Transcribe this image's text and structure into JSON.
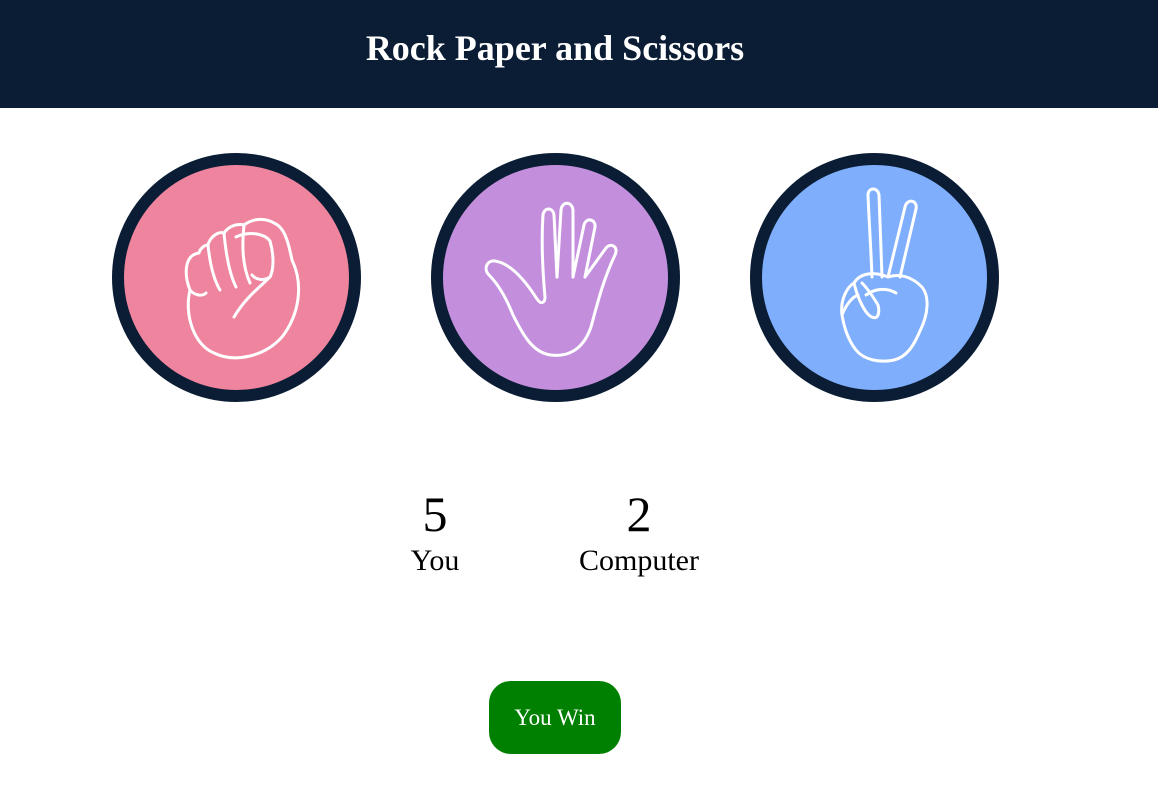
{
  "header": {
    "title": "Rock Paper and Scissors"
  },
  "choices": [
    {
      "id": "rock",
      "icon": "fist-icon",
      "color": "#ef849f"
    },
    {
      "id": "paper",
      "icon": "open-hand-icon",
      "color": "#c38fdd"
    },
    {
      "id": "scissors",
      "icon": "peace-sign-icon",
      "color": "#7faefc"
    }
  ],
  "scoreboard": {
    "user": {
      "score": "5",
      "label": "You"
    },
    "computer": {
      "score": "2",
      "label": "Computer"
    }
  },
  "result": {
    "text": "You Win",
    "color": "#008000"
  },
  "theme": {
    "dark": "#0b1d34"
  }
}
